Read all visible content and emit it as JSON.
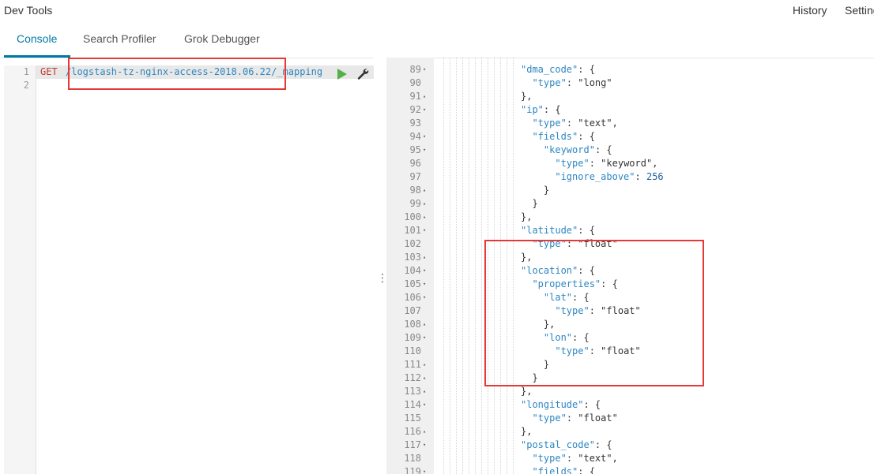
{
  "app": {
    "title": "Dev Tools"
  },
  "topnav": {
    "history": "History",
    "settings": "Settings"
  },
  "tabs": [
    {
      "label": "Console",
      "active": true
    },
    {
      "label": "Search Profiler",
      "active": false
    },
    {
      "label": "Grok Debugger",
      "active": false
    }
  ],
  "request": {
    "line_numbers": [
      "1",
      "2"
    ],
    "method": "GET",
    "path": "/logstash-tz-nginx-access-2018.06.22/_mapping"
  },
  "response": {
    "lines": [
      {
        "n": "89",
        "fold": "open",
        "text": "\"dma_code\": {"
      },
      {
        "n": "90",
        "fold": "",
        "text": "  \"type\": \"long\""
      },
      {
        "n": "91",
        "fold": "close",
        "text": "},"
      },
      {
        "n": "92",
        "fold": "open",
        "text": "\"ip\": {"
      },
      {
        "n": "93",
        "fold": "",
        "text": "  \"type\": \"text\","
      },
      {
        "n": "94",
        "fold": "open",
        "text": "  \"fields\": {"
      },
      {
        "n": "95",
        "fold": "open",
        "text": "    \"keyword\": {"
      },
      {
        "n": "96",
        "fold": "",
        "text": "      \"type\": \"keyword\","
      },
      {
        "n": "97",
        "fold": "",
        "text": "      \"ignore_above\": 256"
      },
      {
        "n": "98",
        "fold": "close",
        "text": "    }"
      },
      {
        "n": "99",
        "fold": "close",
        "text": "  }"
      },
      {
        "n": "100",
        "fold": "close",
        "text": "},"
      },
      {
        "n": "101",
        "fold": "open",
        "text": "\"latitude\": {"
      },
      {
        "n": "102",
        "fold": "",
        "text": "  \"type\": \"float\""
      },
      {
        "n": "103",
        "fold": "close",
        "text": "},"
      },
      {
        "n": "104",
        "fold": "open",
        "text": "\"location\": {"
      },
      {
        "n": "105",
        "fold": "open",
        "text": "  \"properties\": {"
      },
      {
        "n": "106",
        "fold": "open",
        "text": "    \"lat\": {"
      },
      {
        "n": "107",
        "fold": "",
        "text": "      \"type\": \"float\""
      },
      {
        "n": "108",
        "fold": "close",
        "text": "    },"
      },
      {
        "n": "109",
        "fold": "open",
        "text": "    \"lon\": {"
      },
      {
        "n": "110",
        "fold": "",
        "text": "      \"type\": \"float\""
      },
      {
        "n": "111",
        "fold": "close",
        "text": "    }"
      },
      {
        "n": "112",
        "fold": "close",
        "text": "  }"
      },
      {
        "n": "113",
        "fold": "close",
        "text": "},"
      },
      {
        "n": "114",
        "fold": "open",
        "text": "\"longitude\": {"
      },
      {
        "n": "115",
        "fold": "",
        "text": "  \"type\": \"float\""
      },
      {
        "n": "116",
        "fold": "close",
        "text": "},"
      },
      {
        "n": "117",
        "fold": "open",
        "text": "\"postal_code\": {"
      },
      {
        "n": "118",
        "fold": "",
        "text": "  \"type\": \"text\","
      },
      {
        "n": "119",
        "fold": "open",
        "text": "  \"fields\": {"
      }
    ]
  },
  "colors": {
    "accent": "#0079a5",
    "highlight": "#e53935",
    "run": "#54b04a",
    "method": "#c0392b",
    "path": "#2e86c1"
  },
  "icons": {
    "run": "play-icon",
    "settings": "wrench-icon",
    "resize": "vertical-dots-icon"
  }
}
